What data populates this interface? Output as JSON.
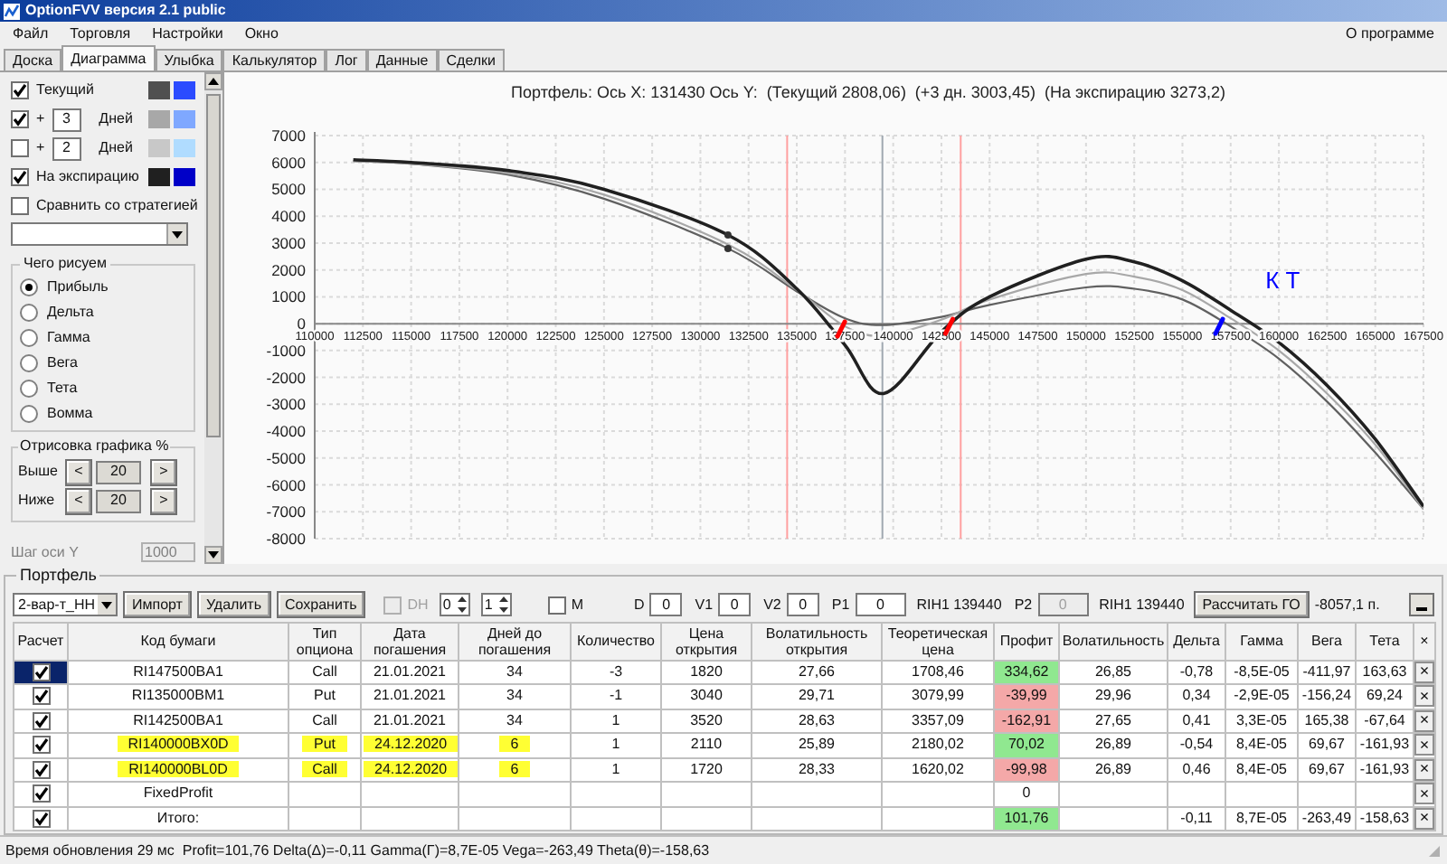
{
  "window": {
    "title": "OptionFVV версия 2.1 public"
  },
  "menu": [
    {
      "label": "Файл"
    },
    {
      "label": "Торговля"
    },
    {
      "label": "Настройки"
    },
    {
      "label": "Окно"
    }
  ],
  "menu_right": "О программе",
  "tabs": [
    {
      "label": "Доска",
      "selected": false
    },
    {
      "label": "Диаграмма",
      "selected": true
    },
    {
      "label": "Улыбка",
      "selected": false
    },
    {
      "label": "Калькулятор",
      "selected": false
    },
    {
      "label": "Лог",
      "selected": false
    },
    {
      "label": "Данные",
      "selected": false
    },
    {
      "label": "Сделки",
      "selected": false
    }
  ],
  "chart_settings": {
    "lines": [
      {
        "kind": "plain",
        "label": "Текущий",
        "checked": true,
        "swatches": [
          {
            "color": "#505050"
          },
          {
            "color": "#2b4bff"
          }
        ]
      },
      {
        "kind": "days",
        "prefix": "+",
        "value": "3",
        "label": "Дней",
        "checked": true,
        "swatches": [
          {
            "color": "#a8a8a8"
          },
          {
            "color": "#7fa8ff"
          }
        ]
      },
      {
        "kind": "days",
        "prefix": "+",
        "value": "2",
        "label": "Дней",
        "checked": false,
        "swatches": [
          {
            "color": "#c8c8c8"
          },
          {
            "color": "#b0dcff"
          }
        ]
      },
      {
        "kind": "plain",
        "label": "На экспирацию",
        "checked": true,
        "swatches": [
          {
            "color": "#202020"
          },
          {
            "color": "#0000c8"
          }
        ]
      }
    ],
    "compare": {
      "label": "Сравнить со стратегией",
      "checked": false
    },
    "draw_group": {
      "title": "Чего рисуем",
      "options": [
        {
          "label": "Прибыль",
          "selected": true
        },
        {
          "label": "Дельта",
          "selected": false
        },
        {
          "label": "Гамма",
          "selected": false
        },
        {
          "label": "Вега",
          "selected": false
        },
        {
          "label": "Тета",
          "selected": false
        },
        {
          "label": "Вомма",
          "selected": false
        }
      ]
    },
    "range_group": {
      "title": "Отрисовка графика %",
      "rows": [
        {
          "label": "Выше",
          "decrease": "<",
          "value": "20",
          "increase": ">"
        },
        {
          "label": "Ниже",
          "decrease": "<",
          "value": "20",
          "increase": ">"
        }
      ]
    },
    "y_step": {
      "label": "Шаг оси Y",
      "value": "1000",
      "disabled": true
    }
  },
  "chart": {
    "chart_data": {
      "type": "line",
      "title": "Портфель: Ось X: 131430 Ось Y:  (Текущий 2808,06)  (+3 дн. 3003,45)  (На экспирацию 3273,2)",
      "x": [
        112000,
        115000,
        120000,
        125000,
        131430,
        135000,
        137500,
        139500,
        142500,
        145000,
        150000,
        152500,
        155000,
        157500,
        160000,
        162500,
        165000,
        167500
      ],
      "series": [
        {
          "color": "#606060",
          "values": [
            6050,
            5950,
            5550,
            4650,
            2800,
            1200,
            200,
            -50,
            250,
            700,
            1350,
            1300,
            900,
            -100,
            -1300,
            -2900,
            -4800,
            -6900
          ]
        },
        {
          "color": "#a8a8a8",
          "values": [
            6050,
            5950,
            5600,
            4800,
            2950,
            1250,
            -100,
            -450,
            150,
            900,
            1850,
            1750,
            1250,
            200,
            -1000,
            -2600,
            -4500,
            -6900
          ]
        },
        {
          "color": "#202020",
          "values": [
            6100,
            6000,
            5700,
            5000,
            3300,
            1300,
            -800,
            -2600,
            -300,
            1000,
            2400,
            2300,
            1600,
            500,
            -700,
            -2300,
            -4300,
            -6800
          ]
        }
      ],
      "xlim": [
        110000,
        167500
      ],
      "ylim": [
        -8000,
        7000
      ],
      "xticks": [
        110000,
        112500,
        115000,
        117500,
        120000,
        122500,
        125000,
        127500,
        130000,
        132500,
        135000,
        137500,
        140000,
        142500,
        145000,
        147500,
        150000,
        152500,
        155000,
        157500,
        160000,
        162500,
        165000,
        167500
      ],
      "yticks": [
        -8000,
        -7000,
        -6000,
        -5000,
        -4000,
        -3000,
        -2000,
        -1000,
        0,
        1000,
        2000,
        3000,
        4000,
        5000,
        6000,
        7000
      ],
      "grid": true,
      "ref_lines": [
        {
          "axis": "x",
          "value": 134500,
          "color": "#ffa0a0"
        },
        {
          "axis": "x",
          "value": 139440,
          "color": "#a0a8b0"
        },
        {
          "axis": "x",
          "value": 143500,
          "color": "#ffa0a0"
        }
      ],
      "annotations": [
        "К Т"
      ]
    }
  },
  "portfolio": {
    "title": "Портфель",
    "toolbar": {
      "strategy": "2-вар-т_НН",
      "buttons": [
        "Импорт",
        "Удалить",
        "Сохранить"
      ],
      "dh": {
        "label": "DH",
        "checked": false,
        "disabled": true
      },
      "spinners": [
        "0",
        "1"
      ],
      "m": {
        "label": "М",
        "checked": false
      },
      "fields": [
        {
          "label": "D",
          "value": "0"
        },
        {
          "label": "V1",
          "value": "0"
        },
        {
          "label": "V2",
          "value": "0"
        }
      ],
      "p1": {
        "label": "P1",
        "value": "0",
        "instrument": "RIH1 139440",
        "disabled": false
      },
      "p2": {
        "label": "P2",
        "value": "0",
        "instrument": "RIH1 139440",
        "disabled": true
      },
      "calc_button": "Рассчитать ГО",
      "margin": "-8057,1 п."
    },
    "table": {
      "columns": [
        "Расчет",
        "Код бумаги",
        "Тип опциона",
        "Дата погашения",
        "Дней до погашения",
        "Количество",
        "Цена открытия",
        "Волатильность открытия",
        "Теоретическая цена",
        "Профит",
        "Волатильность",
        "Дельта",
        "Гамма",
        "Вега",
        "Тета",
        "×"
      ],
      "rows": [
        {
          "checked": true,
          "selected": true,
          "highlighted": false,
          "color": "#90e890",
          "cells": [
            null,
            "RI147500BA1",
            "Call",
            "21.01.2021",
            "34",
            "-3",
            "1820",
            "27,66",
            "1708,46",
            "334,62",
            "26,85",
            "-0,78",
            "-8,5E-05",
            "-411,97",
            "163,63"
          ],
          "remove": "×"
        },
        {
          "checked": true,
          "selected": false,
          "highlighted": false,
          "color": "#f4a8a8",
          "cells": [
            null,
            "RI135000BM1",
            "Put",
            "21.01.2021",
            "34",
            "-1",
            "3040",
            "29,71",
            "3079,99",
            "-39,99",
            "29,96",
            "0,34",
            "-2,9E-05",
            "-156,24",
            "69,24"
          ],
          "remove": "×"
        },
        {
          "checked": true,
          "selected": false,
          "highlighted": false,
          "color": "#f4a8a8",
          "cells": [
            null,
            "RI142500BA1",
            "Call",
            "21.01.2021",
            "34",
            "1",
            "3520",
            "28,63",
            "3357,09",
            "-162,91",
            "27,65",
            "0,41",
            "3,3E-05",
            "165,38",
            "-67,64"
          ],
          "remove": "×"
        },
        {
          "checked": true,
          "selected": false,
          "highlighted": true,
          "color": "#90e890",
          "cells": [
            null,
            "RI140000BX0D",
            "Put",
            "24.12.2020",
            "6",
            "1",
            "2110",
            "25,89",
            "2180,02",
            "70,02",
            "26,89",
            "-0,54",
            "8,4E-05",
            "69,67",
            "-161,93"
          ],
          "remove": "×"
        },
        {
          "checked": true,
          "selected": false,
          "highlighted": true,
          "color": "#f4a8a8",
          "cells": [
            null,
            "RI140000BL0D",
            "Call",
            "24.12.2020",
            "6",
            "1",
            "1720",
            "28,33",
            "1620,02",
            "-99,98",
            "26,89",
            "0,46",
            "8,4E-05",
            "69,67",
            "-161,93"
          ],
          "remove": "×"
        },
        {
          "checked": true,
          "selected": false,
          "highlighted": false,
          "cells": [
            null,
            "FixedProfit",
            null,
            null,
            null,
            null,
            null,
            null,
            null,
            "0",
            null,
            null,
            null,
            null,
            null
          ],
          "remove": "×"
        },
        {
          "checked": true,
          "selected": false,
          "highlighted": false,
          "color": "#90e890",
          "cells": [
            null,
            "Итого:",
            null,
            null,
            null,
            null,
            null,
            null,
            null,
            "101,76",
            null,
            "-0,11",
            "8,7E-05",
            "-263,49",
            "-158,63"
          ],
          "remove": "×"
        }
      ]
    }
  },
  "status_bar": "Время обновления 29 мс  Profit=101,76 Delta(Δ)=-0,11 Gamma(Γ)=8,7E-05 Vega=-263,49 Theta(θ)=-158,63"
}
